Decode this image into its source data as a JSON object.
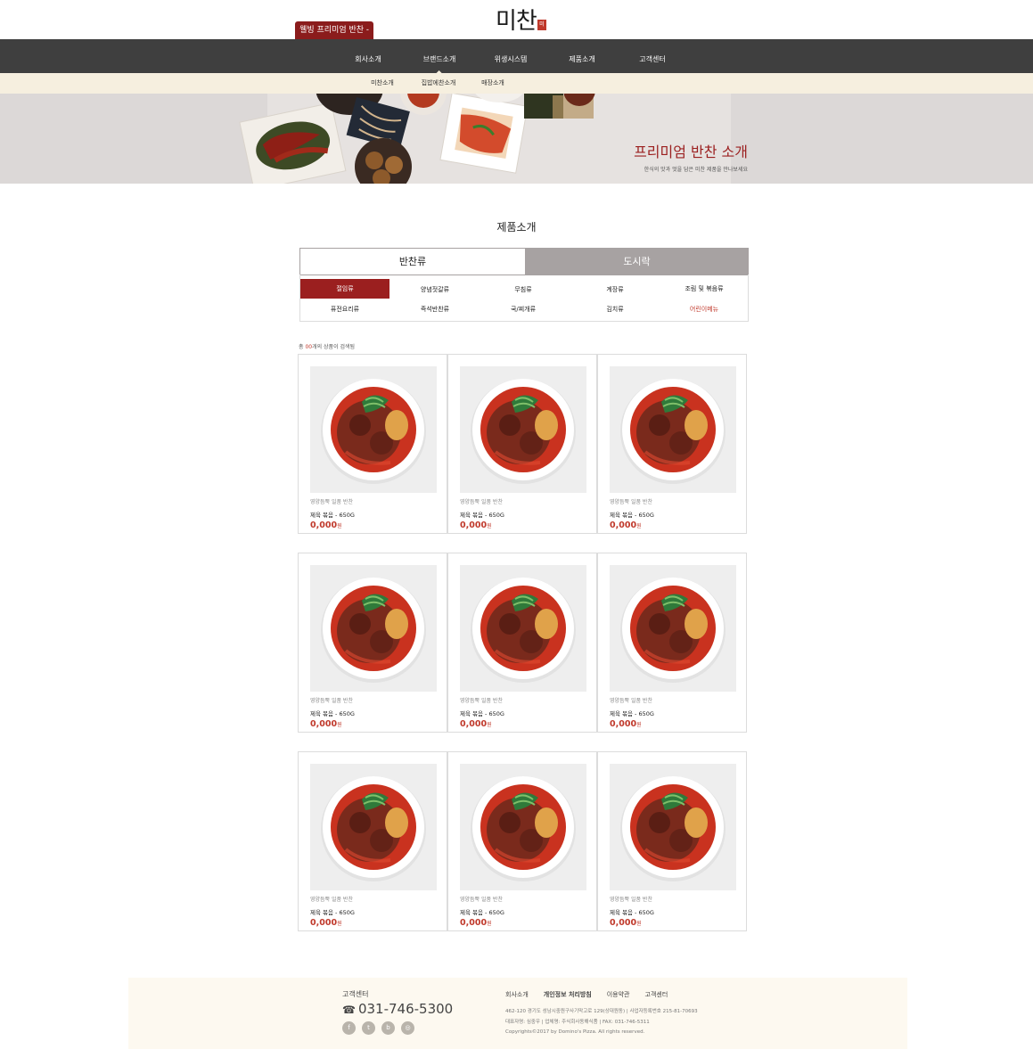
{
  "header": {
    "badge": "웰빙 프리미엄 반찬 -",
    "logo": "미찬",
    "logo_seal": "미"
  },
  "gnb": [
    {
      "label": "회사소개"
    },
    {
      "label": "브랜드소개",
      "active": true
    },
    {
      "label": "위생시스템"
    },
    {
      "label": "제품소개"
    },
    {
      "label": "고객센터"
    }
  ],
  "subnav": [
    {
      "label": "미찬소개"
    },
    {
      "label": "집밥에찬소개"
    },
    {
      "label": "매장소개"
    }
  ],
  "banner": {
    "title": "프리미엄 반찬 소개",
    "subtitle": "한식의 맛과 멋을 담은 미찬 제품을 만나보세요"
  },
  "section": {
    "title": "제품소개"
  },
  "tabs": [
    {
      "label": "반찬류",
      "active": true
    },
    {
      "label": "도시락",
      "active": false
    }
  ],
  "categories": [
    {
      "label": "절임류",
      "active": true
    },
    {
      "label": "양념젓갈류"
    },
    {
      "label": "무침류"
    },
    {
      "label": "계장류"
    },
    {
      "label": "조림 및 볶음류"
    },
    {
      "label": "퓨전요리류"
    },
    {
      "label": "즉석반찬류"
    },
    {
      "label": "국/찌개류"
    },
    {
      "label": "김치류"
    },
    {
      "label": "어린이메뉴",
      "highlight": true
    }
  ],
  "result": {
    "prefix": "총 ",
    "count": "00",
    "suffix": "개의 상품이 검색됨"
  },
  "products": [
    {
      "category": "영양듬뿍 일품 반찬",
      "name": "제육 볶음 - 650G",
      "price": "0,000",
      "unit": "원"
    },
    {
      "category": "영양듬뿍 일품 반찬",
      "name": "제육 볶음 - 650G",
      "price": "0,000",
      "unit": "원"
    },
    {
      "category": "영양듬뿍 일품 반찬",
      "name": "제육 볶음 - 650G",
      "price": "0,000",
      "unit": "원"
    },
    {
      "category": "영양듬뿍 일품 반찬",
      "name": "제육 볶음 - 650G",
      "price": "0,000",
      "unit": "원"
    },
    {
      "category": "영양듬뿍 일품 반찬",
      "name": "제육 볶음 - 650G",
      "price": "0,000",
      "unit": "원"
    },
    {
      "category": "영양듬뿍 일품 반찬",
      "name": "제육 볶음 - 650G",
      "price": "0,000",
      "unit": "원"
    },
    {
      "category": "영양듬뿍 일품 반찬",
      "name": "제육 볶음 - 650G",
      "price": "0,000",
      "unit": "원"
    },
    {
      "category": "영양듬뿍 일품 반찬",
      "name": "제육 볶음 - 650G",
      "price": "0,000",
      "unit": "원"
    },
    {
      "category": "영양듬뿍 일품 반찬",
      "name": "제육 볶음 - 650G",
      "price": "0,000",
      "unit": "원"
    }
  ],
  "footer": {
    "cs_label": "고객센터",
    "phone": "031-746-5300",
    "phone_icon": "☎",
    "sns": [
      {
        "icon": "facebook-icon",
        "glyph": "f"
      },
      {
        "icon": "twitter-icon",
        "glyph": "t"
      },
      {
        "icon": "blog-icon",
        "glyph": "b"
      },
      {
        "icon": "instagram-icon",
        "glyph": "◎"
      }
    ],
    "links": [
      {
        "label": "회사소개"
      },
      {
        "label": "개인정보 처리방침"
      },
      {
        "label": "이용약관"
      },
      {
        "label": "고객센터"
      }
    ],
    "address": "462-120 경기도 성남시중원구사기막고로 129(상대원동) | 사업자등록번호 215-81-70693",
    "company": "대표자명: 심중우 | 업체명: 주식회사동해식품 | FAX: 031-746-5311",
    "copyright": "Copyrights©2017 by Domino's Pizza. All rights reserved."
  },
  "colors": {
    "brand_red": "#9b1f1f",
    "gnb_bg": "#3f3f3f",
    "sub_bg": "#f6efdf",
    "tab_inactive": "#a7a2a2"
  }
}
